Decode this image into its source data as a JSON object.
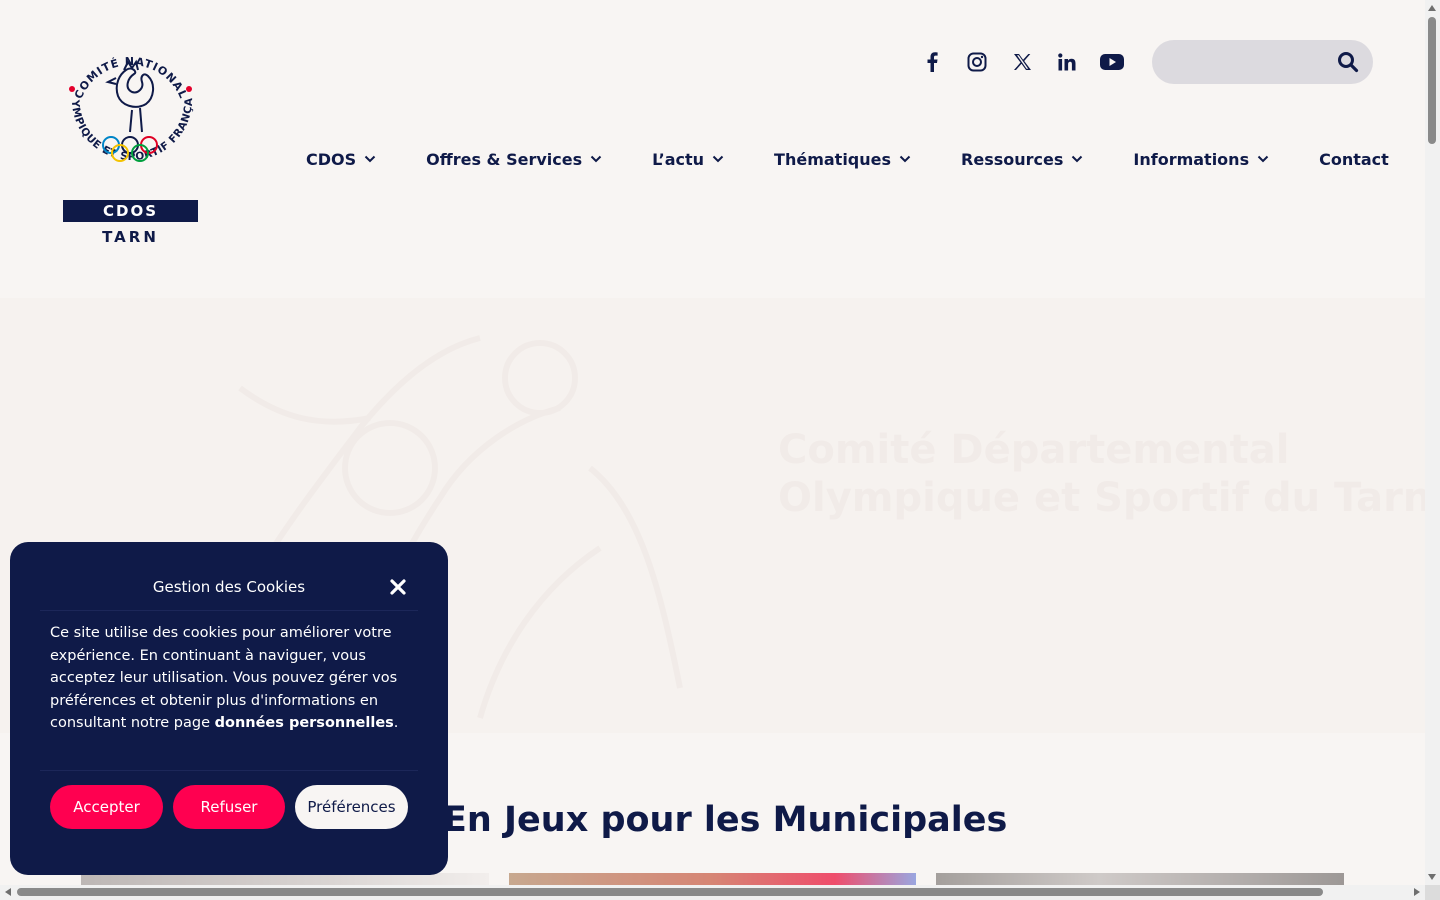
{
  "logo": {
    "arc_text": "COMITÉ NATIONAL OLYMPIQUE ET SPORTIF FRANÇAIS",
    "box_label": "CDOS",
    "sub_label": "TARN"
  },
  "social": [
    "facebook-icon",
    "instagram-icon",
    "x-twitter-icon",
    "linkedin-icon",
    "youtube-icon"
  ],
  "search": {
    "placeholder": "",
    "value": ""
  },
  "nav": {
    "items": [
      {
        "label": "CDOS",
        "dropdown": true
      },
      {
        "label": "Offres & Services",
        "dropdown": true
      },
      {
        "label": "L’actu",
        "dropdown": true
      },
      {
        "label": "Thématiques",
        "dropdown": true
      },
      {
        "label": "Ressources",
        "dropdown": true
      },
      {
        "label": "Informations",
        "dropdown": true
      },
      {
        "label": "Contact",
        "dropdown": false
      }
    ]
  },
  "hero": {
    "title_line1": "Comité Départemental",
    "title_line2": "Olympique et Sportif du Tarn"
  },
  "section": {
    "title": "En Jeux pour les Municipales"
  },
  "cookie": {
    "title": "Gestion des Cookies",
    "text_before": "Ce site utilise des cookies pour améliorer votre expérience. En continuant à naviguer, vous acceptez leur utilisation. Vous pouvez gérer vos préférences et obtenir plus d'informations en consultant notre page ",
    "link": "données personnelles",
    "text_after": ".",
    "accept": "Accepter",
    "refuse": "Refuser",
    "preferences": "Préférences"
  },
  "colors": {
    "navy": "#0f1a48",
    "accent": "#ff0050",
    "background": "#f8f5f3",
    "search_bg": "#dcdadf"
  }
}
